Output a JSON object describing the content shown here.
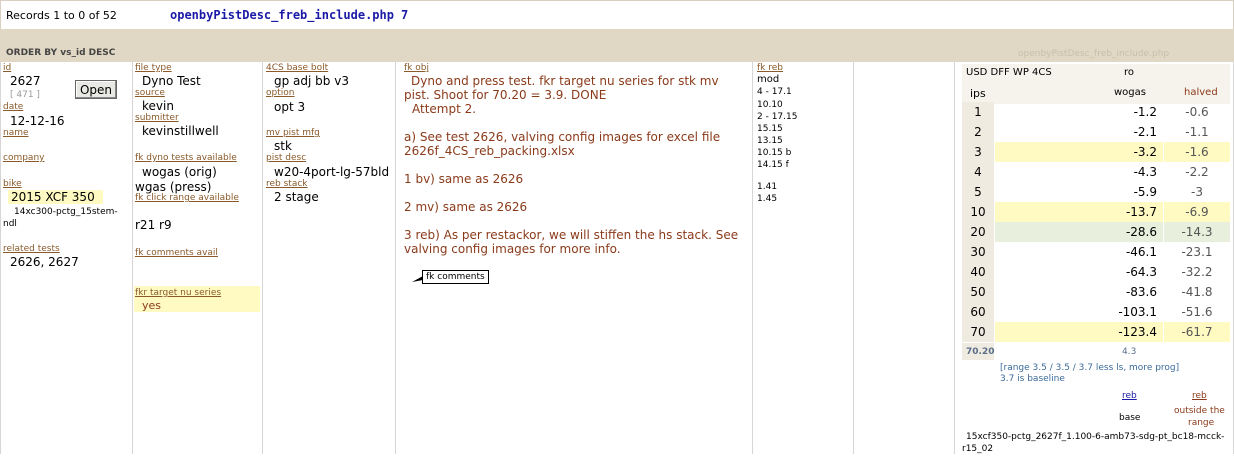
{
  "header": {
    "records": "Records 1 to 0 of 52",
    "php_name": "openbyPistDesc_freb_include.php",
    "php_num": "7",
    "order_by": "ORDER BY vs_id DESC",
    "php_name_faded": "openbyPistDesc_freb_include.php"
  },
  "col1": {
    "id_label": "id",
    "id_value": "2627",
    "id_sub": "[ 471 ]",
    "open_label": "Open",
    "date_label": "date",
    "date_value": "12-12-16",
    "name_label": "name",
    "company_label": "company",
    "bike_label": "bike",
    "bike_value": "2015 XCF 350",
    "bike_note1": "14xc300-pctg_15stem-",
    "bike_note2": "ndl",
    "related_label": "related tests",
    "related_value": "2626, 2627"
  },
  "col2": {
    "file_type_label": "file type",
    "file_type_value": "Dyno Test",
    "source_label": "source",
    "source_value": "kevin",
    "submitter_label": "submitter",
    "submitter_value": "kevinstillwell",
    "dyno_label": "fk dyno tests available",
    "dyno_value1": "wogas (orig)",
    "dyno_value2": "wgas (press)",
    "click_label": "fk click range available",
    "click_value": "r21  r9",
    "comments_label": "fk comments avail",
    "target_label": "fkr target nu series",
    "target_value": "yes"
  },
  "col3": {
    "base_bolt_label": "4CS base bolt",
    "base_bolt_value": "gp adj bb v3",
    "option_label": "option",
    "option_value": "opt 3",
    "mv_label": "mv pist mfg",
    "mv_value": "stk",
    "pist_label": "pist desc",
    "pist_value": "w20-4port-lg-57bld",
    "reb_label": "reb stack",
    "reb_value": "2 stage"
  },
  "col4": {
    "label": "fk obj",
    "p1": "Dyno and press test. fkr target nu series for stk mv pist. Shoot for 70.20 = 3.9. DONE",
    "p1b": "Attempt 2.",
    "p2": "a) See test 2626, valving config images for excel file 2626f_4CS_reb_packing.xlsx",
    "p3": "1 bv) same as 2626",
    "p4": "2 mv) same as 2626",
    "p5": "3 reb) As per restackor, we will stiffen the hs stack. See valving config images for more info.",
    "comments_note": "fk comments"
  },
  "col5": {
    "label": "fk reb",
    "mod": "mod",
    "rows": [
      "4 - 17.1",
      "10.10",
      "2 - 17.15",
      "15.15",
      "13.15",
      "10.15 b",
      "14.15 f"
    ],
    "rows2": [
      "1.41",
      "1.45"
    ]
  },
  "table": {
    "title": "USD DFF WP 4CS",
    "ro": "ro",
    "ips_label": "ips",
    "wogas_label": "wogas",
    "halved_label": "halved",
    "rows": [
      {
        "ips": "1",
        "wogas": "-1.2",
        "halved": "-0.6"
      },
      {
        "ips": "2",
        "wogas": "-2.1",
        "halved": "-1.1"
      },
      {
        "ips": "3",
        "wogas": "-3.2",
        "halved": "-1.6"
      },
      {
        "ips": "4",
        "wogas": "-4.3",
        "halved": "-2.2"
      },
      {
        "ips": "5",
        "wogas": "-5.9",
        "halved": "-3"
      },
      {
        "ips": "10",
        "wogas": "-13.7",
        "halved": "-6.9"
      },
      {
        "ips": "20",
        "wogas": "-28.6",
        "halved": "-14.3"
      },
      {
        "ips": "30",
        "wogas": "-46.1",
        "halved": "-23.1"
      },
      {
        "ips": "40",
        "wogas": "-64.3",
        "halved": "-32.2"
      },
      {
        "ips": "50",
        "wogas": "-83.6",
        "halved": "-41.8"
      },
      {
        "ips": "60",
        "wogas": "-103.1",
        "halved": "-51.6"
      },
      {
        "ips": "70",
        "wogas": "-123.4",
        "halved": "-61.7"
      }
    ],
    "summary_ips": "70.20",
    "summary_value": "4.3",
    "range_note": "[range 3.5 / 3.5 / 3.7 less ls, more prog]",
    "baseline_note": "3.7 is baseline",
    "reb1_label": "reb",
    "reb2_label": "reb",
    "base_label": "base",
    "outside_label1": "outside the",
    "outside_label2": "range",
    "file1": "15xcf350-pctg_2627f_1.100-6-amb73-sdg-pt_bc18-mcck-",
    "file2": "r15_02"
  },
  "colors": {
    "header_bg": "#e0d8c4",
    "highlight": "#fff9c2",
    "label": "#8a5a2a",
    "accent": "#1a1aa6"
  }
}
